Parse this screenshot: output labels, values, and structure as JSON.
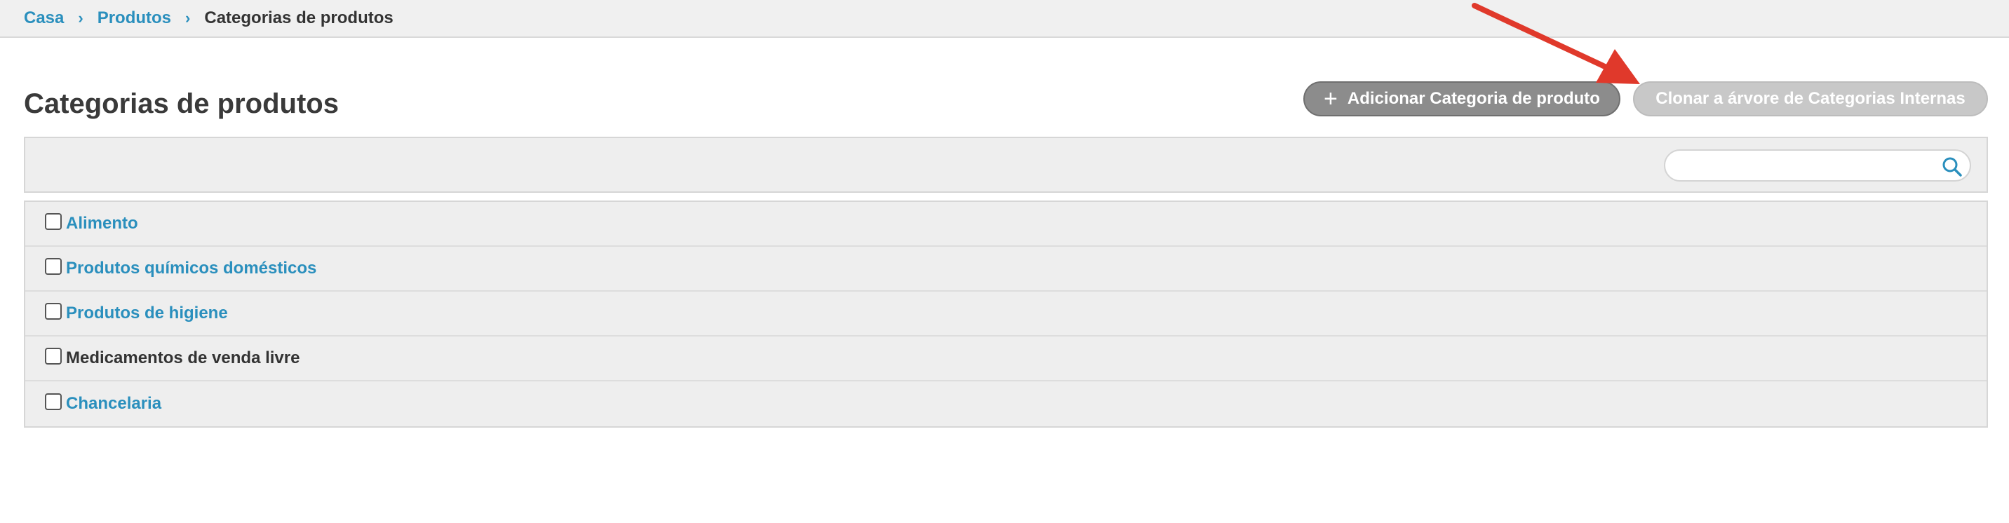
{
  "breadcrumb": {
    "items": [
      "Casa",
      "Produtos"
    ],
    "separator": "›",
    "current": "Categorias de produtos"
  },
  "page": {
    "title": "Categorias de produtos"
  },
  "toolbar": {
    "add_label": "Adicionar Categoria de produto",
    "clone_label": "Clonar a árvore de Categorias Internas"
  },
  "search": {
    "value": "",
    "icon": "search-icon"
  },
  "categories": [
    {
      "label": "Alimento",
      "is_link": true
    },
    {
      "label": "Produtos químicos domésticos",
      "is_link": true
    },
    {
      "label": "Produtos de higiene",
      "is_link": true
    },
    {
      "label": "Medicamentos de venda livre",
      "is_link": false
    },
    {
      "label": "Chancelaria",
      "is_link": true
    }
  ],
  "colors": {
    "link": "#2a8fbd",
    "annotation_arrow": "#e0392b"
  }
}
